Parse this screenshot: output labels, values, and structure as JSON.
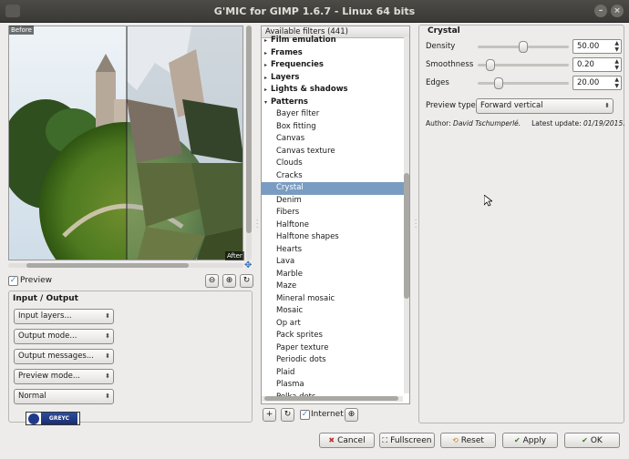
{
  "window": {
    "title": "G'MIC for GIMP 1.6.7 - Linux 64 bits"
  },
  "preview": {
    "before_label": "Before",
    "after_label": "After",
    "checkbox_label": "Preview",
    "checked": true
  },
  "io": {
    "title": "Input / Output",
    "combos": [
      "Input layers...",
      "Output mode...",
      "Output messages...",
      "Preview mode...",
      "Normal"
    ]
  },
  "logo": {
    "text": "GREYC"
  },
  "filters": {
    "header": "Available filters (441)",
    "rows": [
      {
        "label": "Film emulation",
        "type": "category"
      },
      {
        "label": "Frames",
        "type": "category"
      },
      {
        "label": "Frequencies",
        "type": "category"
      },
      {
        "label": "Layers",
        "type": "category"
      },
      {
        "label": "Lights & shadows",
        "type": "category"
      },
      {
        "label": "Patterns",
        "type": "category-open"
      },
      {
        "label": "Bayer filter",
        "type": "item"
      },
      {
        "label": "Box fitting",
        "type": "item"
      },
      {
        "label": "Canvas",
        "type": "item"
      },
      {
        "label": "Canvas texture",
        "type": "item"
      },
      {
        "label": "Clouds",
        "type": "item"
      },
      {
        "label": "Cracks",
        "type": "item"
      },
      {
        "label": "Crystal",
        "type": "item",
        "selected": true
      },
      {
        "label": "Denim",
        "type": "item"
      },
      {
        "label": "Fibers",
        "type": "item"
      },
      {
        "label": "Halftone",
        "type": "item"
      },
      {
        "label": "Halftone shapes",
        "type": "item"
      },
      {
        "label": "Hearts",
        "type": "item"
      },
      {
        "label": "Lava",
        "type": "item"
      },
      {
        "label": "Marble",
        "type": "item"
      },
      {
        "label": "Maze",
        "type": "item"
      },
      {
        "label": "Mineral mosaic",
        "type": "item"
      },
      {
        "label": "Mosaic",
        "type": "item"
      },
      {
        "label": "Op art",
        "type": "item"
      },
      {
        "label": "Pack sprites",
        "type": "item"
      },
      {
        "label": "Paper texture",
        "type": "item"
      },
      {
        "label": "Periodic dots",
        "type": "item"
      },
      {
        "label": "Plaid",
        "type": "item"
      },
      {
        "label": "Plasma",
        "type": "item"
      },
      {
        "label": "Polka dots",
        "type": "item"
      }
    ],
    "internet_label": "Internet",
    "internet_checked": true
  },
  "params": {
    "title": "Crystal",
    "density": {
      "label": "Density",
      "value": "50.00",
      "fraction": 0.5
    },
    "smoothness": {
      "label": "Smoothness",
      "value": "0.20",
      "fraction": 0.1
    },
    "edges": {
      "label": "Edges",
      "value": "20.00",
      "fraction": 0.2
    },
    "preview_type": {
      "label": "Preview type",
      "value": "Forward vertical"
    },
    "author_label": "Author:",
    "author_name": "David Tschumperlé.",
    "update_label": "Latest update:",
    "update_date": "01/19/2015."
  },
  "buttons": {
    "cancel": "Cancel",
    "fullscreen": "Fullscreen",
    "reset": "Reset",
    "apply": "Apply",
    "ok": "OK"
  }
}
